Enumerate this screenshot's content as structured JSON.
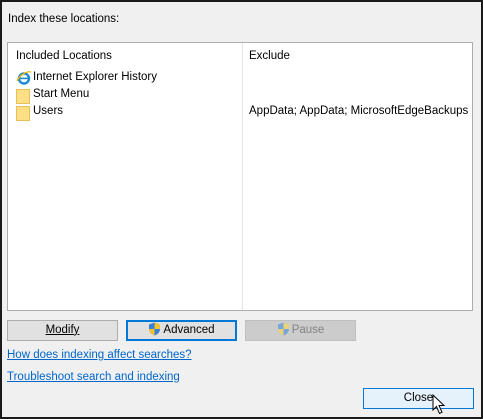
{
  "heading": "Index these locations:",
  "list": {
    "columns": {
      "included": "Included Locations",
      "exclude": "Exclude"
    },
    "rows": [
      {
        "label": "Internet Explorer History",
        "exclude": "",
        "icon": "internet-explorer-icon"
      },
      {
        "label": "Start Menu",
        "exclude": "",
        "icon": "folder-icon"
      },
      {
        "label": "Users",
        "exclude": "AppData; AppData; MicrosoftEdgeBackups",
        "icon": "folder-icon"
      }
    ]
  },
  "buttons": {
    "modify": "Modify",
    "advanced": "Advanced",
    "pause": "Pause",
    "close": "Close"
  },
  "links": {
    "indexing_affect": "How does indexing affect searches?",
    "troubleshoot": "Troubleshoot search and indexing"
  },
  "colors": {
    "accent": "#0078d7",
    "link": "#0066cc",
    "folder": "#fde086"
  }
}
